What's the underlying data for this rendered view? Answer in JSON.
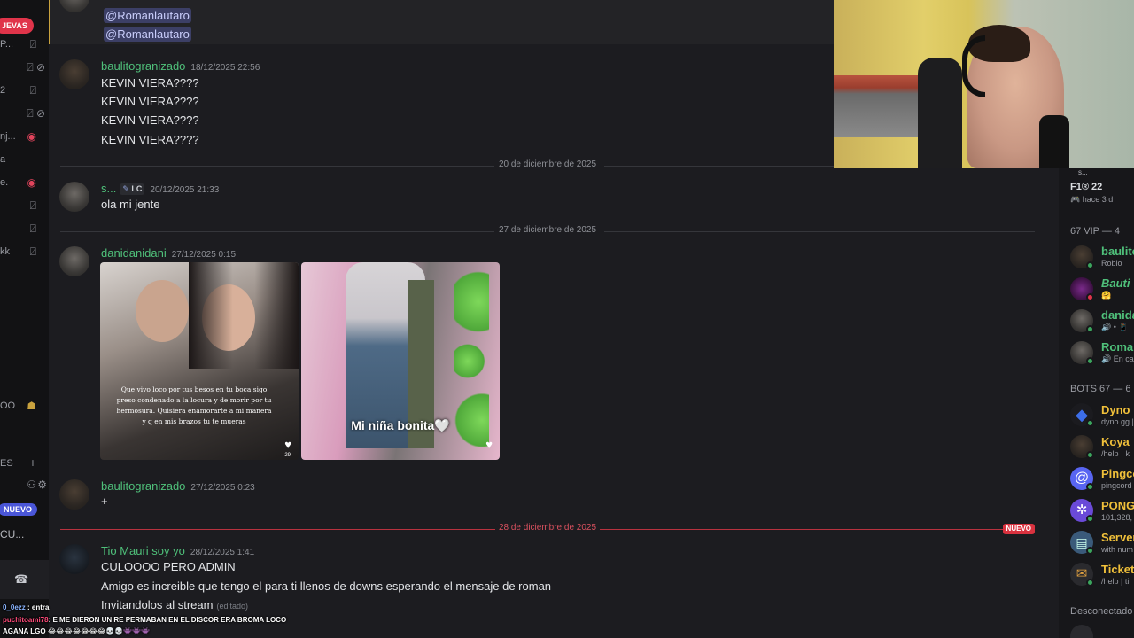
{
  "left_rail": {
    "new_badge": "JEVAS",
    "rows": [
      {
        "text": "P...",
        "icon": "mic-muted-icon"
      },
      {
        "text": "",
        "icon": "mic-deaf-icon"
      },
      {
        "text": "2",
        "icon": "mic-muted-icon"
      },
      {
        "text": "",
        "icon": "mic-deaf-icon"
      },
      {
        "text": "nj...",
        "icon": "live-icon"
      },
      {
        "text": "a",
        "icon": ""
      },
      {
        "text": "e.",
        "icon": "live-icon"
      },
      {
        "text": "",
        "icon": "mic-muted-icon"
      },
      {
        "text": "",
        "icon": "mic-muted-icon"
      },
      {
        "text": "kk",
        "icon": "mic-muted-icon"
      }
    ],
    "misc_1": "OO",
    "section": "ES",
    "nuevo_badge": "NUEVO",
    "channel": "CU..."
  },
  "chat": {
    "mentions": [
      "@Romanlautaro",
      "@Romanlautaro"
    ],
    "messages": [
      {
        "user": "baulitogranizado",
        "time": "18/12/2025 22:56",
        "lines": [
          "KEVIN VIERA????",
          "KEVIN VIERA????",
          "KEVIN VIERA????",
          "KEVIN VIERA????"
        ]
      },
      {
        "user": "s...",
        "tag": "LC",
        "time": "20/12/2025 21:33",
        "lines": [
          "ola mi jente"
        ]
      },
      {
        "user": "danidanidani",
        "time": "27/12/2025 0:15",
        "lines": []
      },
      {
        "user": "baulitogranizado",
        "time": "27/12/2025 0:23",
        "lines": [
          "+"
        ]
      },
      {
        "user": "Tio Mauri soy yo",
        "time": "28/12/2025 1:41",
        "lines": [
          "CULOOOO PERO ADMIN",
          "Amigo es increible que tengo el para ti llenos de downs esperando el mensaje de roman",
          "Invitandolos al stream"
        ],
        "edited": "(editado)"
      }
    ],
    "dividers": [
      "20 de diciembre de 2025",
      "27 de diciembre de 2025",
      "28 de diciembre de 2025"
    ],
    "new_label": "NUEVO",
    "image1_caption": "Que vivo loco por tus besos en tu boca sigo preso condenado a la locura y de morir por tu hermosura. Quisiera enamorarte a mi manera y q en mis brazos tu te mueras",
    "image1_likes": "29",
    "image2_caption": "Mi niña bonita🤍"
  },
  "right_panel": {
    "top_name": "s...",
    "top_game": "F1® 22",
    "top_activity": "hace 3 d",
    "vip_header": "67 VIP — 4",
    "vip": [
      {
        "name": "baulito",
        "sub": "Roblo",
        "color": "#4fc07a",
        "dot": "green"
      },
      {
        "name": "Bauti",
        "sub": "🤗",
        "color": "#4fc07a",
        "dot": "red"
      },
      {
        "name": "danida",
        "sub": "🔊 • 📱",
        "color": "#4fc07a",
        "dot": "green"
      },
      {
        "name": "Romar",
        "sub": "🔊 En ca",
        "color": "#4fc07a",
        "dot": "green"
      }
    ],
    "bots_header": "BOTS 67 — 6",
    "bots": [
      {
        "name": "Dyno",
        "sub": "dyno.gg |",
        "color": "#f0c03a"
      },
      {
        "name": "Koya",
        "sub": "/help · k",
        "color": "#f0c03a"
      },
      {
        "name": "Pingco",
        "sub": "pingcord",
        "color": "#f0c03a"
      },
      {
        "name": "PONG",
        "sub": "101,328,",
        "color": "#f0c03a"
      },
      {
        "name": "Server",
        "sub": "with num",
        "color": "#f0c03a"
      },
      {
        "name": "Ticket",
        "sub": "/help | ti",
        "color": "#f0c03a"
      }
    ],
    "offline_header": "Desconectado"
  },
  "overlay_chat": {
    "line1_user": "0_0ezz",
    "line1_text": ": entra",
    "line2_user": "puchitoami78",
    "line2_text": ": E ME DIERON UN RE PERMABAN EN EL DISCOR ERA BROMA LOCO",
    "line3_text": "AGANA LGO 😂😂😂😂😂😂😂💀💀👾👾👾"
  },
  "colors": {
    "username": "#4fc07a",
    "new_divider": "#d9323f",
    "mention_bg": "#3c3f66",
    "bot_name": "#f0c03a"
  }
}
